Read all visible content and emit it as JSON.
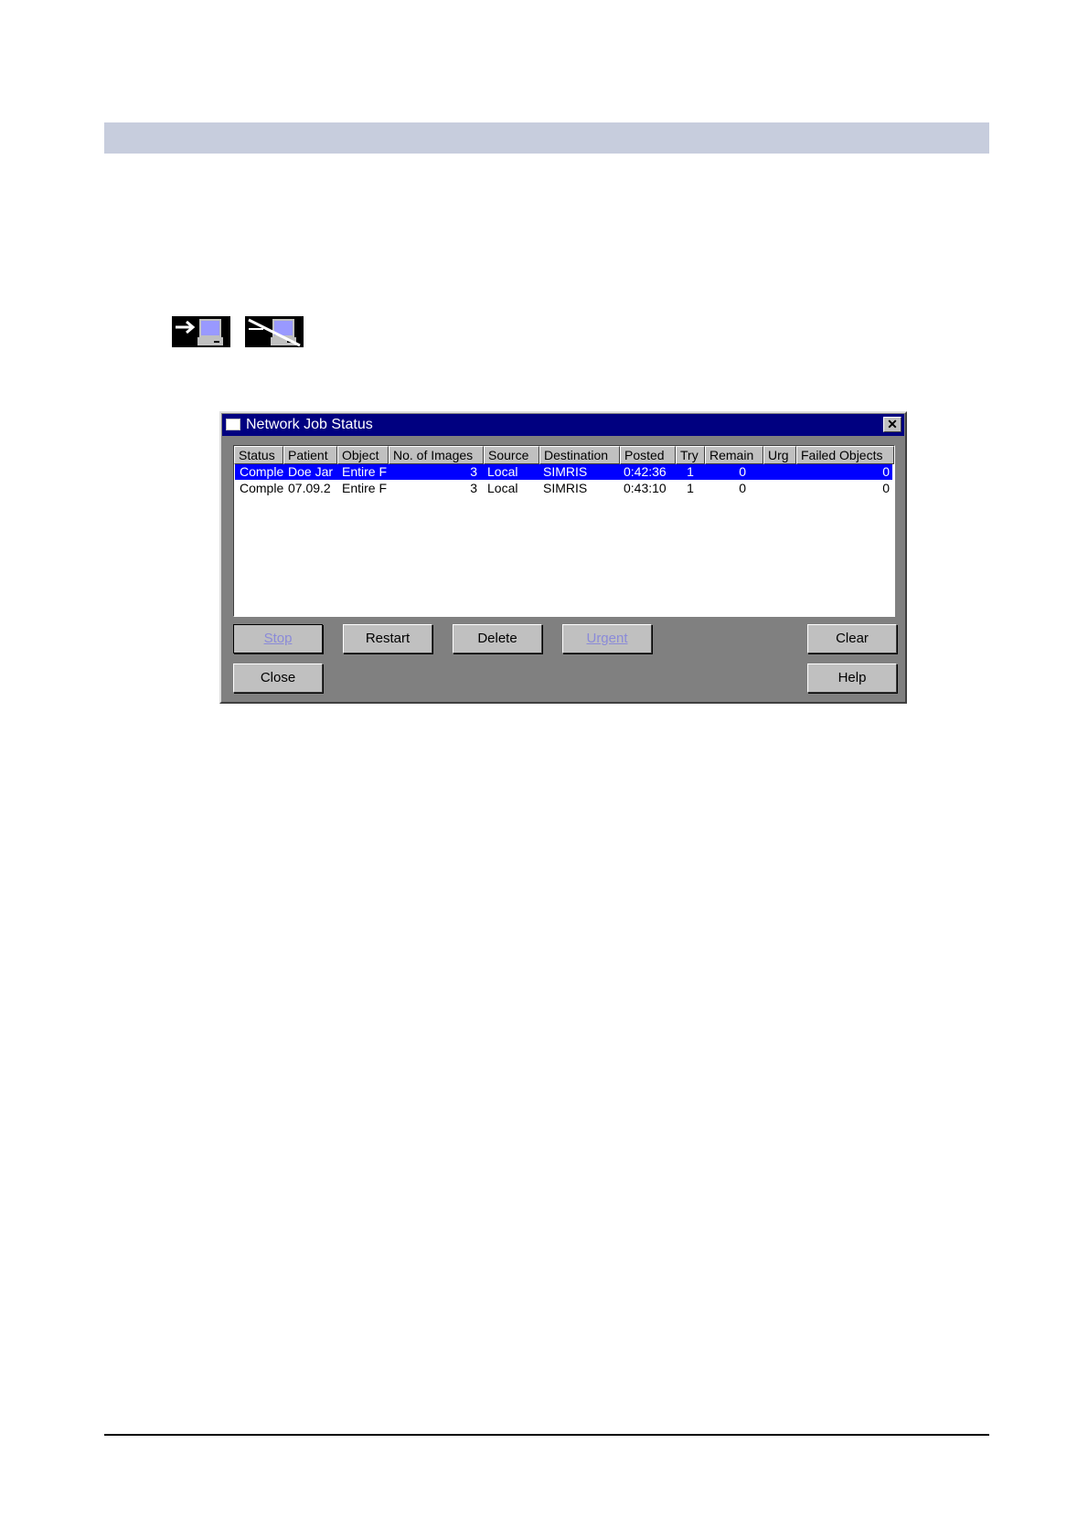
{
  "dialog": {
    "title": "Network Job Status",
    "close_glyph": "✕",
    "columns": [
      "Status",
      "Patient",
      "Object",
      "No. of Images",
      "Source",
      "Destination",
      "Posted",
      "Try",
      "Remain",
      "Urg",
      "Failed Objects"
    ],
    "rows": [
      {
        "selected": true,
        "status": "Comple",
        "patient": "Doe Jar",
        "object": "Entire F",
        "images": "3",
        "source": "Local",
        "destination": "SIMRIS",
        "posted": "0:42:36",
        "try": "1",
        "remain": "0",
        "urg": "",
        "failed": "0"
      },
      {
        "selected": false,
        "status": "Comple",
        "patient": "07.09.2",
        "object": "Entire F",
        "images": "3",
        "source": "Local",
        "destination": "SIMRIS",
        "posted": "0:43:10",
        "try": "1",
        "remain": "0",
        "urg": "",
        "failed": "0"
      }
    ],
    "buttons": {
      "stop": "Stop",
      "restart": "Restart",
      "delete": "Delete",
      "urgent": "Urgent",
      "clear": "Clear",
      "close": "Close",
      "help": "Help"
    }
  },
  "icons": [
    "network-send-icon",
    "network-disconnected-icon"
  ],
  "colors": {
    "title_bar": "#000080",
    "selection": "#0000ff",
    "dialog_bg": "#808080",
    "button_bg": "#c0c0c0",
    "top_band": "#c7cddd"
  }
}
